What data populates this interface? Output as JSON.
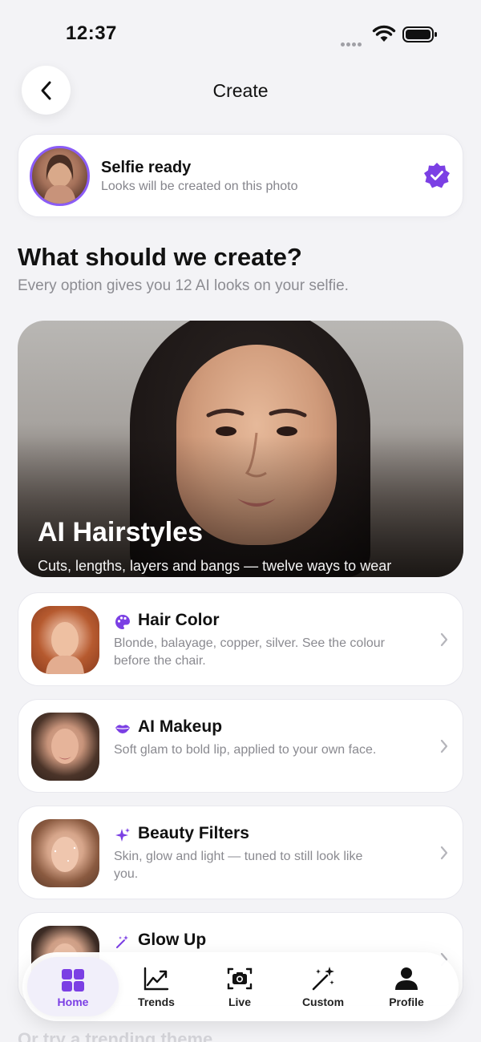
{
  "status_bar": {
    "time": "12:37"
  },
  "header": {
    "title": "Create"
  },
  "selfie": {
    "title": "Selfie ready",
    "subtitle": "Looks will be created on this photo"
  },
  "section": {
    "heading": "What should we create?",
    "subheading": "Every option gives you 12 AI looks on your selfie."
  },
  "hero": {
    "title": "AI Hairstyles",
    "subtitle": "Cuts, lengths, layers and bangs — twelve ways to wear"
  },
  "options": [
    {
      "title": "Hair Color",
      "icon": "palette-icon",
      "desc": "Blonde, balayage, copper, silver. See the colour before the chair."
    },
    {
      "title": "AI Makeup",
      "icon": "lips-icon",
      "desc": "Soft glam to bold lip, applied to your own face."
    },
    {
      "title": "Beauty Filters",
      "icon": "sparkles-icon",
      "desc": "Skin, glow and light — tuned to still look like you."
    },
    {
      "title": "Glow Up",
      "icon": "magic-wand-icon",
      "desc": ""
    }
  ],
  "nav": {
    "items": [
      {
        "label": "Home",
        "icon": "grid-icon",
        "active": true
      },
      {
        "label": "Trends",
        "icon": "trend-chart-icon",
        "active": false
      },
      {
        "label": "Live",
        "icon": "camera-icon",
        "active": false
      },
      {
        "label": "Custom",
        "icon": "magic-wand-icon",
        "active": false
      },
      {
        "label": "Profile",
        "icon": "person-icon",
        "active": false
      }
    ]
  },
  "peek": {
    "text": "Or try a trending theme"
  },
  "colors": {
    "accent": "#7b3fe4",
    "background": "#f3f3f6",
    "card": "#ffffff"
  }
}
